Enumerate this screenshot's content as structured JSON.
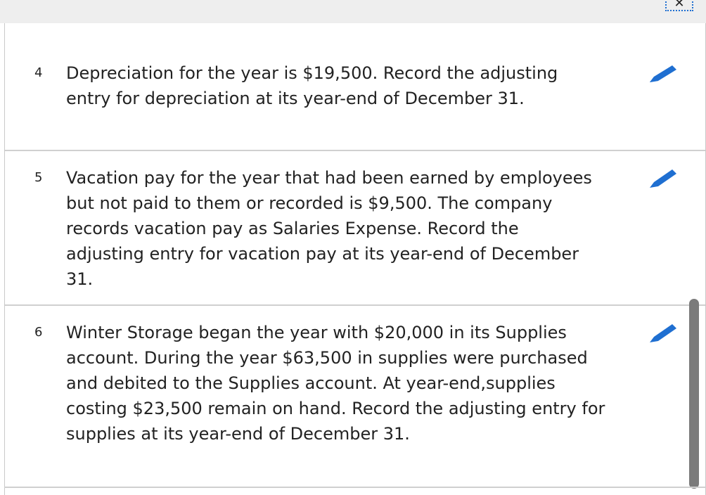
{
  "header": {
    "close_icon": "close-icon",
    "close_glyph": "✕"
  },
  "items": [
    {
      "number": "4",
      "text": "Depreciation for the year is $19,500. Record the adjusting entry for depreciation at its year-end of December 31.",
      "action_icon": "pencil-icon"
    },
    {
      "number": "5",
      "text": "Vacation pay for the year that had been earned by employees but not paid to them or recorded is $9,500. The company records vacation pay as Salaries Expense. Record the adjusting entry for vacation pay at its year-end of December 31.",
      "action_icon": "pencil-icon"
    },
    {
      "number": "6",
      "text": "Winter Storage began the year with $20,000 in its Supplies account. During the year $63,500 in supplies were purchased and debited to the Supplies account. At year-end,supplies costing $23,500 remain on hand. Record the adjusting entry for supplies at its year-end of December 31.",
      "action_icon": "pencil-icon"
    }
  ],
  "colors": {
    "accent": "#1f6fd1",
    "text": "#222222",
    "divider": "#d0d0d0",
    "scrollbar": "#7b7b7b"
  }
}
